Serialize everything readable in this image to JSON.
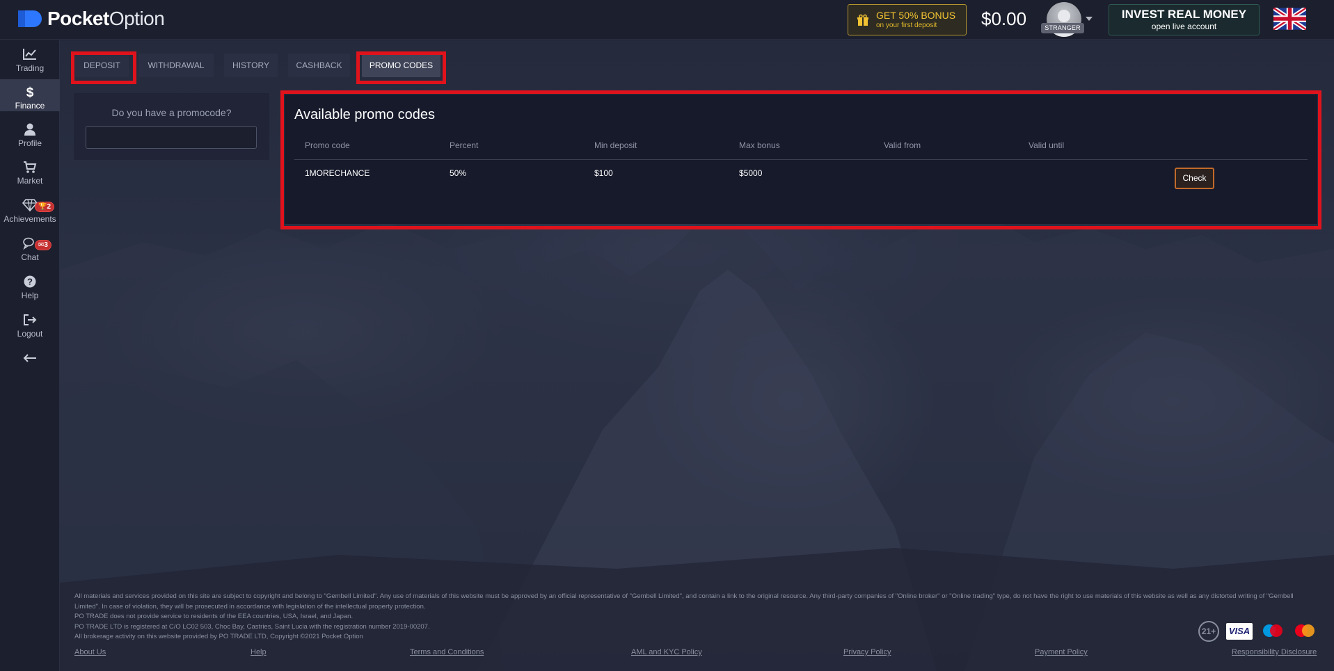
{
  "header": {
    "logo_bold": "Pocket",
    "logo_light": "Option",
    "bonus_main": "GET 50% BONUS",
    "bonus_sub": "on your first deposit",
    "balance": "$0.00",
    "avatar_badge": "STRANGER",
    "invest_main": "INVEST REAL MONEY",
    "invest_sub": "open live account",
    "flag_icon": "uk-flag-icon"
  },
  "sidebar": {
    "items": [
      {
        "label": "Trading",
        "icon": "chart-line-icon"
      },
      {
        "label": "Finance",
        "icon": "dollar-icon"
      },
      {
        "label": "Profile",
        "icon": "user-icon"
      },
      {
        "label": "Market",
        "icon": "cart-icon"
      },
      {
        "label": "Achievements",
        "icon": "diamond-icon",
        "badge": "2"
      },
      {
        "label": "Chat",
        "icon": "chat-icon",
        "badge": "3"
      },
      {
        "label": "Help",
        "icon": "question-icon"
      },
      {
        "label": "Logout",
        "icon": "logout-icon"
      }
    ],
    "collapse_icon": "arrow-left-icon"
  },
  "tabs": [
    {
      "label": "DEPOSIT"
    },
    {
      "label": "WITHDRAWAL"
    },
    {
      "label": "HISTORY"
    },
    {
      "label": "CASHBACK"
    },
    {
      "label": "PROMO CODES"
    }
  ],
  "promo_entry": {
    "question": "Do you have a promocode?",
    "value": ""
  },
  "available": {
    "title": "Available promo codes",
    "columns": [
      "Promo code",
      "Percent",
      "Min deposit",
      "Max bonus",
      "Valid from",
      "Valid until"
    ],
    "rows": [
      {
        "code": "1MORECHANCE",
        "percent": "50%",
        "min_deposit": "$100",
        "max_bonus": "$5000",
        "valid_from": "",
        "valid_until": "",
        "action": "Check"
      }
    ]
  },
  "footer": {
    "lines": [
      "All materials and services provided on this site are subject to copyright and belong to \"Gembell Limited\". Any use of materials of this website must be approved by an official representative of \"Gembell Limited\", and contain a link to the original resource. Any third-party companies of \"Online broker\" or \"Online trading\" type, do not have the right to use materials of this website as well as any distorted writing of \"Gembell Limited\". In case of violation, they will be prosecuted in accordance with legislation of the intellectual property protection.",
      "PO TRADE does not provide service to residents of the EEA countries, USA, Israel, and Japan.",
      "PO TRADE LTD is registered at C/O LC02 503, Choc Bay, Castries, Saint Lucia with the registration number 2019-00207.",
      "All brokerage activity on this website provided by PO TRADE LTD, Copyright ©2021 Pocket Option"
    ],
    "links": [
      "About Us",
      "Help",
      "Terms and Conditions",
      "AML and KYC Policy",
      "Privacy Policy",
      "Payment Policy",
      "Responsibility Disclosure"
    ],
    "age_badge": "21+",
    "payment_icons": [
      "visa-icon",
      "maestro-icon",
      "mastercard-icon"
    ],
    "visa_text": "VISA"
  }
}
